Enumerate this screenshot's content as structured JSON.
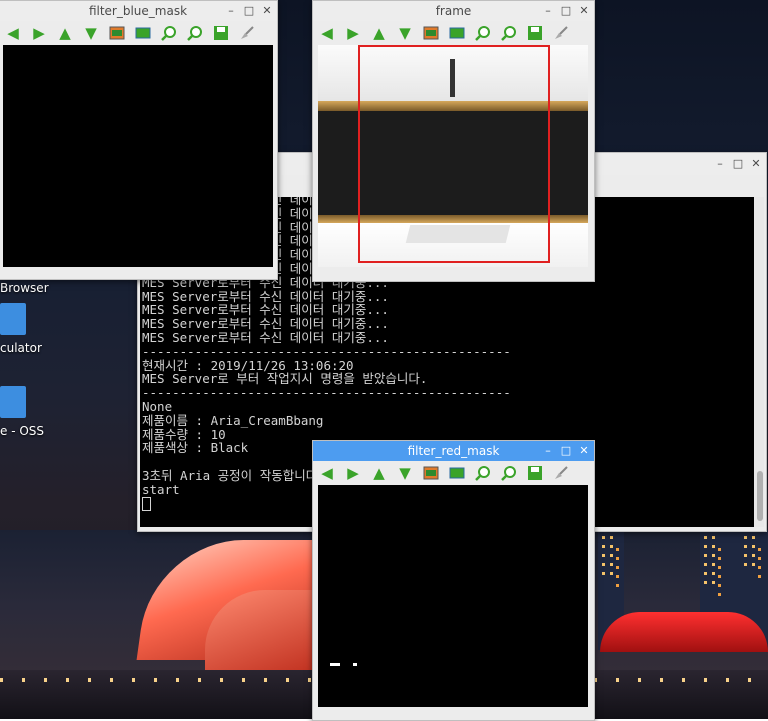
{
  "desktop": {
    "icons": [
      {
        "label": "Browser"
      },
      {
        "label": "culator"
      },
      {
        "label": "e - OSS"
      }
    ]
  },
  "toolbar_icons": [
    "arrow-left-icon",
    "arrow-right-icon",
    "arrow-up-icon",
    "arrow-down-icon",
    "image-icon",
    "map-icon",
    "zoom-in-icon",
    "zoom-out-icon",
    "save-icon",
    "brush-icon"
  ],
  "win_blue": {
    "title": "filter_blue_mask"
  },
  "win_frame": {
    "title": "frame",
    "roi_color": "#e02020"
  },
  "win_red": {
    "title": "filter_red_mask"
  },
  "terminal": {
    "lines": [
      "MES Server로부터 수신 데이터 대기중...",
      "MES Server로부터 수신 데이터 대기중...",
      "MES Server로부터 수신 데이터 대기중...",
      "MES Server로부터 수신 데이터 대기중...",
      "MES Server로부터 수신 데이터 대기중...",
      "MES Server로부터 수신 데이터 대기중...",
      "MES Server로부터 수신 데이터 대기중...",
      "MES Server로부터 수신 데이터 대기중...",
      "MES Server로부터 수신 데이터 대기중...",
      "MES Server로부터 수신 데이터 대기중...",
      "MES Server로부터 수신 데이터 대기중...",
      "-------------------------------------------------",
      "현재시간 : 2019/11/26 13:06:20",
      "MES Server로 부터 작업지시 명령을 받았습니다.",
      "-------------------------------------------------",
      "None",
      "제품이름 : Aria_CreamBbang",
      "제품수량 : 10",
      "제품색상 : Black",
      "",
      "3초뒤 Aria 공정이 작동합니다.",
      "start"
    ]
  },
  "colors": {
    "accent_titlebar": "#4d9cf0",
    "toolbar_green": "#3aa32a"
  }
}
